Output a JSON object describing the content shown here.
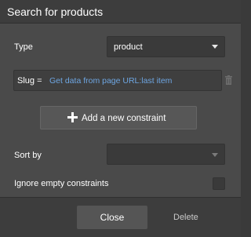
{
  "dialog": {
    "title": "Search for products"
  },
  "fields": {
    "type_label": "Type",
    "type_value": "product",
    "constraint": {
      "key": "Slug =",
      "value": "Get data from page URL:last item"
    },
    "add_constraint_label": "Add a new constraint",
    "sort_by_label": "Sort by",
    "sort_by_value": "",
    "ignore_empty_label": "Ignore empty constraints",
    "ignore_empty_checked": false
  },
  "footer": {
    "close_label": "Close",
    "delete_label": "Delete"
  },
  "icons": {
    "dropdown": "chevron-down-icon",
    "trash": "trash-icon",
    "plus": "plus-icon"
  },
  "colors": {
    "panel_bg": "#4a4a4a",
    "link_blue": "#6ea6e2",
    "text": "#ffffff"
  }
}
